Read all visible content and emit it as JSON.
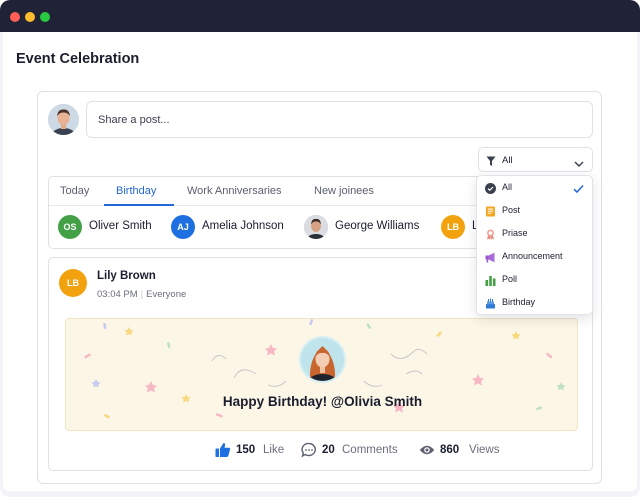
{
  "window": {
    "buttons": [
      "close",
      "minimize",
      "maximize"
    ]
  },
  "page": {
    "title": "Event Celebration"
  },
  "composer": {
    "placeholder": "Share a post..."
  },
  "filter": {
    "selected": "All"
  },
  "tabs": [
    {
      "label": "Today",
      "active": false
    },
    {
      "label": "Birthday",
      "active": true
    },
    {
      "label": "Work Anniversaries",
      "active": false
    },
    {
      "label": "New joinees",
      "active": false
    }
  ],
  "people": [
    {
      "initials": "OS",
      "name": "Oliver Smith",
      "color": "#43a047"
    },
    {
      "initials": "AJ",
      "name": "Amelia Johnson",
      "color": "#1e6fe0"
    },
    {
      "initials": "",
      "name": "George Williams",
      "color": "#b0b6bf"
    },
    {
      "initials": "LB",
      "name": "L",
      "color": "#f2a20f"
    }
  ],
  "post": {
    "author_initials": "LB",
    "author": "Lily Brown",
    "time": "03:04 PM",
    "audience": "Everyone",
    "greeting": "Happy Birthday! @Olivia Smith",
    "likes": "150",
    "likes_label": "Like",
    "comments": "20",
    "comments_label": "Comments",
    "views": "860",
    "views_label": "Views"
  },
  "dropdown": {
    "items": [
      {
        "label": "All",
        "icon": "check-circle-icon",
        "selected": true
      },
      {
        "label": "Post",
        "icon": "post-icon",
        "selected": false
      },
      {
        "label": "Priase",
        "icon": "praise-badge-icon",
        "selected": false
      },
      {
        "label": "Announcement",
        "icon": "megaphone-icon",
        "selected": false
      },
      {
        "label": "Poll",
        "icon": "poll-bars-icon",
        "selected": false
      },
      {
        "label": "Birthday",
        "icon": "cake-icon",
        "selected": false
      }
    ]
  },
  "colors": {
    "accent": "#2567d6",
    "titlebar": "#1f2335",
    "banner": "#fcf6e6"
  }
}
